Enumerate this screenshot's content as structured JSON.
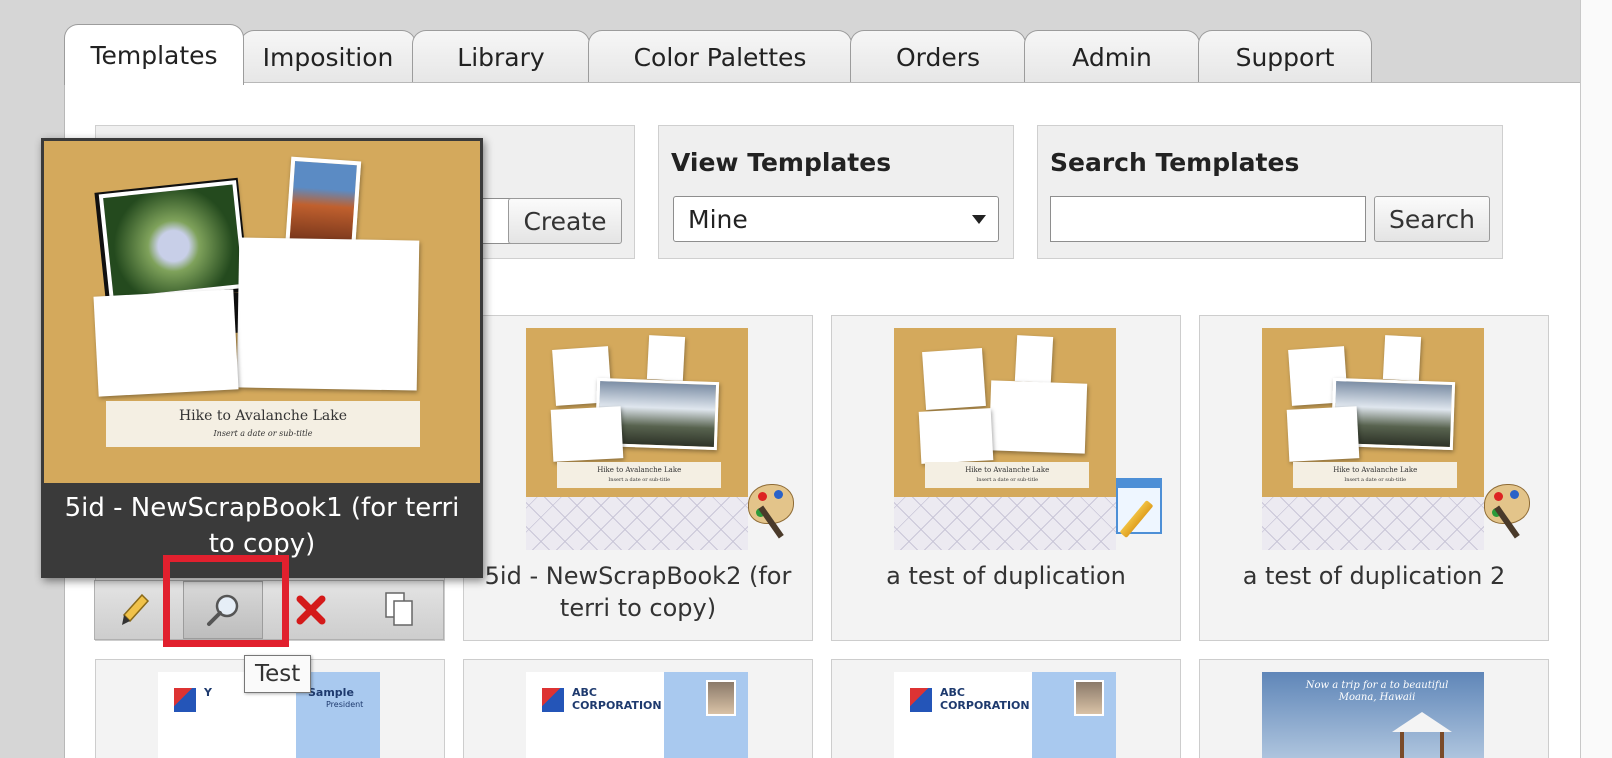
{
  "tabs": [
    {
      "label": "Templates"
    },
    {
      "label": "Imposition"
    },
    {
      "label": "Library"
    },
    {
      "label": "Color Palettes"
    },
    {
      "label": "Orders"
    },
    {
      "label": "Admin"
    },
    {
      "label": "Support"
    }
  ],
  "create": {
    "button_label": "Create"
  },
  "view_templates": {
    "heading": "View Templates",
    "selected": "Mine"
  },
  "search_templates": {
    "heading": "Search Templates",
    "button_label": "Search",
    "value": ""
  },
  "preview": {
    "title": "5id - NewScrapBook1 (for terri to copy)",
    "image_caption": "Hike to Avalanche Lake",
    "image_subcaption": "Insert a date or sub-title"
  },
  "cards": [
    {
      "label": "5id - NewScrapBook2 (for terri to copy)",
      "thumb_caption": "Hike to Avalanche Lake",
      "thumb_subcaption": "Insert a date or sub-title",
      "badge_icon": "palette-icon"
    },
    {
      "label": "a test of duplication",
      "thumb_caption": "Hike to Avalanche Lake",
      "thumb_subcaption": "Insert a date or sub-title",
      "badge_icon": "edit-window-icon"
    },
    {
      "label": "a test of duplication 2",
      "thumb_caption": "Hike to Avalanche Lake",
      "thumb_subcaption": "Insert a date or sub-title",
      "badge_icon": "palette-icon"
    }
  ],
  "bottom_cards": [
    {
      "company": "Y",
      "name": "Sample",
      "title": "President"
    },
    {
      "company": "ABC CORPORATION"
    },
    {
      "company": "ABC CORPORATION"
    },
    {
      "caption": "Now a trip for a to beautiful Moana, Hawaii"
    }
  ],
  "tooltip": {
    "text": "Test"
  },
  "action_icons": [
    "pencil-icon",
    "magnifier-icon",
    "delete-x-icon",
    "copy-icon"
  ],
  "colors": {
    "highlight": "#e1202e",
    "preview_bg": "#3a3a3a",
    "scrap_bg": "#d4a95c"
  }
}
